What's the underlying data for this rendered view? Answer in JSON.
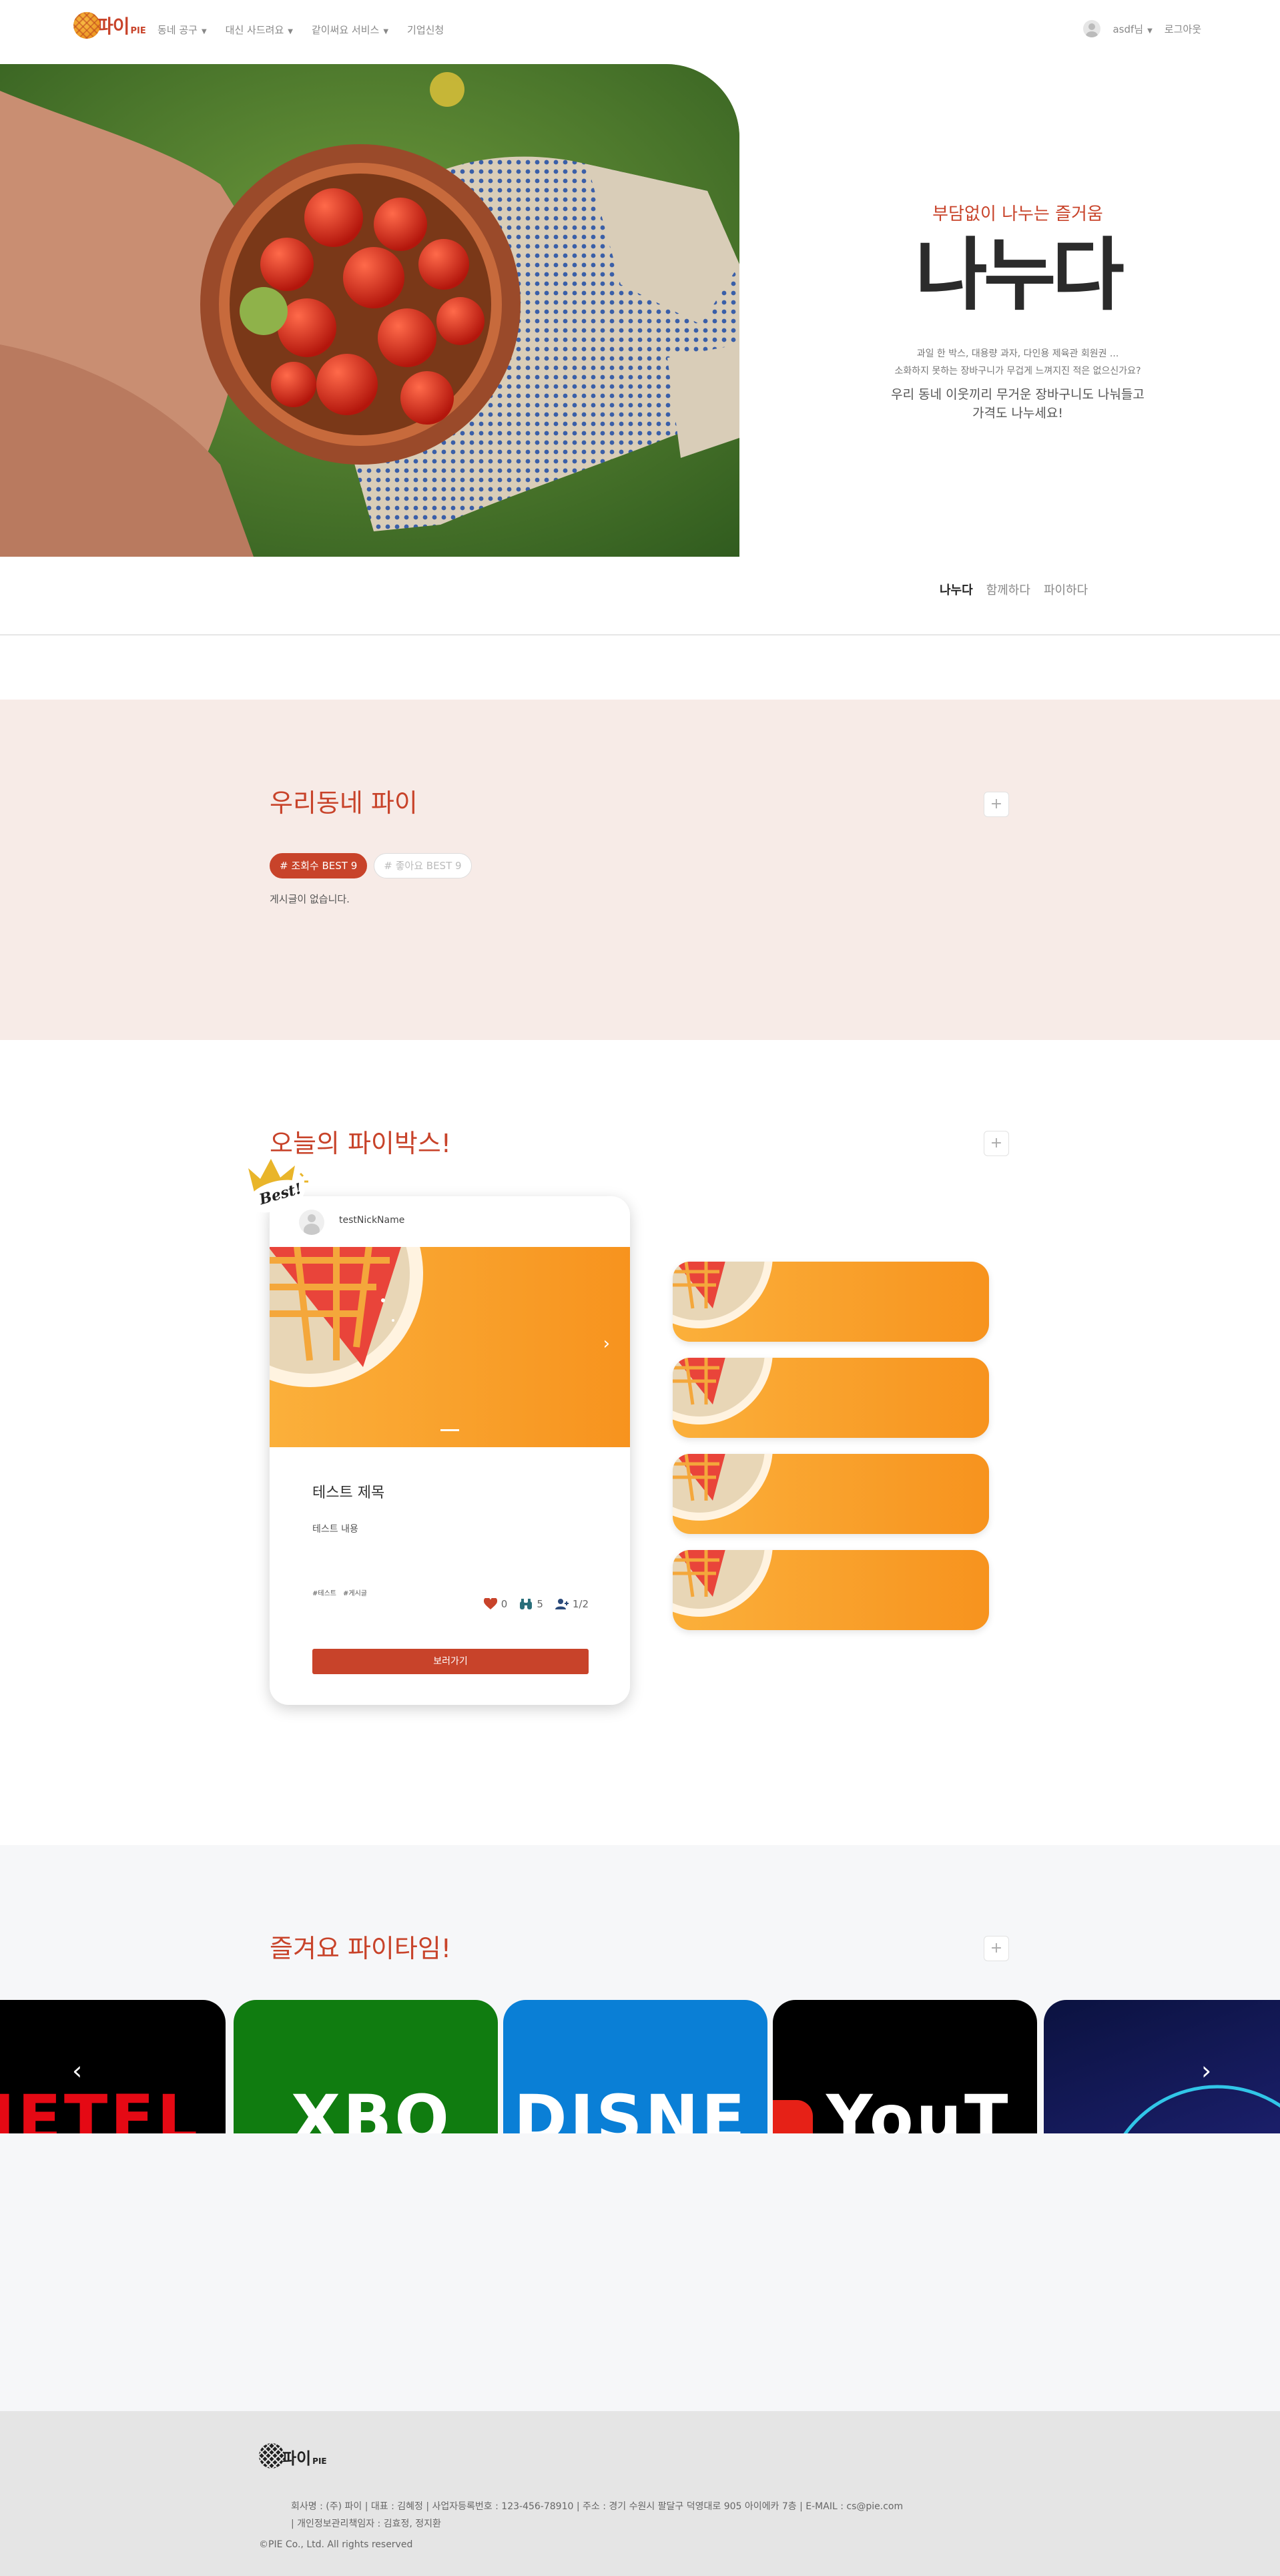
{
  "nav": {
    "logo_text": "파이",
    "logo_sub": "PIE",
    "menu": [
      {
        "label": "동네 공구",
        "has_caret": true
      },
      {
        "label": "대신 사드려요",
        "has_caret": true
      },
      {
        "label": "같이써요 서비스",
        "has_caret": true
      },
      {
        "label": "기업신청",
        "has_caret": false
      }
    ],
    "user_label": "asdf님",
    "logout": "로그아웃"
  },
  "hero": {
    "subtitle": "부담없이 나누는 즐거움",
    "title": "나누다",
    "desc_line1": "과일 한 박스, 대용량 과자, 다인용 제육관 회원권 ...",
    "desc_line2": "소화하지 못하는 장바구니가 무겁게 느껴지진 적은 없으신가요?",
    "desc2_line1": "우리 동네 이웃끼리 무거운 장바구니도 나눠들고",
    "desc2_line2": "가격도 나누세요!",
    "tabs": [
      "나누다",
      "함께하다",
      "파이하다"
    ]
  },
  "neighborhood": {
    "title": "우리동네 파이",
    "plus": "+",
    "pill_active": "# 조회수 BEST 9",
    "pill_inactive": "# 좋아요 BEST 9",
    "empty_text": "게시글이 없습니다."
  },
  "piebox": {
    "title": "오늘의 파이박스!",
    "plus": "+",
    "best_badge": "Best!",
    "card": {
      "nickname": "testNickName",
      "title": "테스트 제목",
      "content": "테스트 내용",
      "tags": [
        "#테스트",
        "#게시글"
      ],
      "likes": "0",
      "views": "5",
      "participants": "1/2",
      "button": "보러가기"
    },
    "mini_count": 4
  },
  "pietime": {
    "title": "즐겨요 파이타임!",
    "plus": "+",
    "prev": "‹",
    "next": "›"
  },
  "footer": {
    "logo_text": "파이",
    "logo_sub": "PIE",
    "info_line1": "회사명 : (주) 파이 | 대표 : 김혜정 | 사업자등록번호 : 123-456-78910 | 주소 : 경기 수원시 팔달구 덕영대로 905 아이에카 7층 | E-MAIL : cs@pie.com",
    "info_line2": "| 개인정보관리책임자 : 김효정, 정지환",
    "copyright": "©PIE Co., Ltd. All rights reserved"
  },
  "colors": {
    "accent": "#c8432a",
    "pink_bg": "#f7ebe7",
    "gray_bg": "#f6f7f9",
    "orange": "#f7931e"
  }
}
